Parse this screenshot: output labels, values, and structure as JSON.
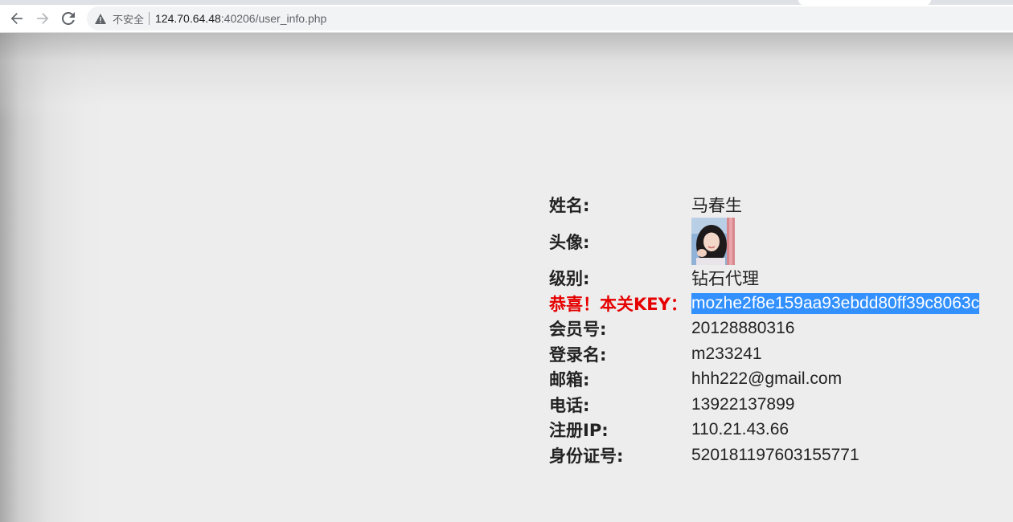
{
  "browser": {
    "security_text": "不安全",
    "url_host": "124.70.64.48",
    "url_rest": ":40206/user_info.php",
    "icons": [
      "back-arrow-icon",
      "forward-arrow-icon",
      "reload-icon",
      "warning-triangle-icon"
    ]
  },
  "user_info": {
    "name_label": "姓名:",
    "name_value": "马春生",
    "avatar_label": "头像:",
    "level_label": "级别:",
    "level_value": "钻石代理",
    "key_label": "恭喜！本关KEY：",
    "key_value": "mozhe2f8e159aa93ebdd80ff39c8063c",
    "member_label": "会员号:",
    "member_value": "20128880316",
    "login_label": "登录名:",
    "login_value": "m233241",
    "email_label": "邮箱:",
    "email_value": "hhh222@gmail.com",
    "phone_label": "电话:",
    "phone_value": "13922137899",
    "ip_label": "注册IP:",
    "ip_value": "110.21.43.66",
    "id_label": "身份证号:",
    "id_value": "520181197603155771"
  },
  "colors": {
    "page_bg": "#ededed",
    "key_label": "#e60000",
    "selection_bg": "#3390ff",
    "text": "#222222"
  }
}
